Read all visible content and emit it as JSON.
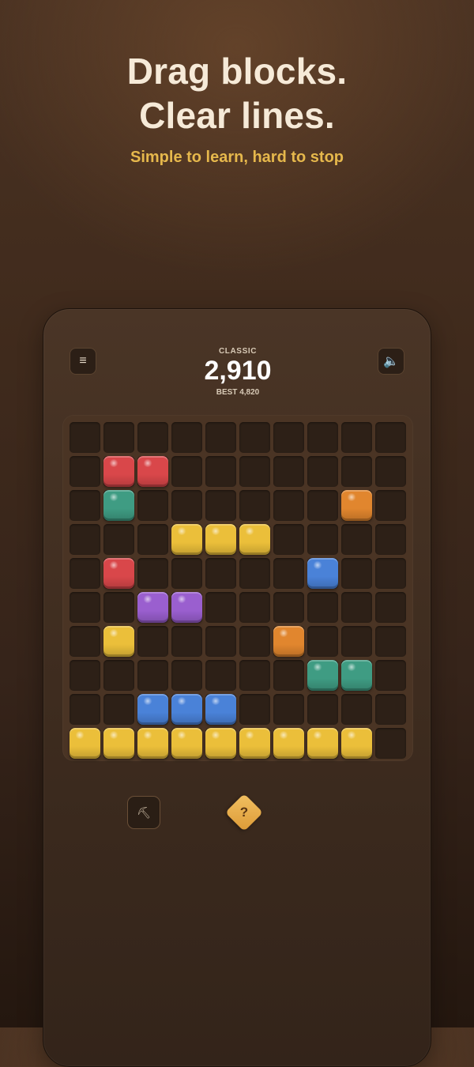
{
  "hero": {
    "headline_line1": "Drag blocks.",
    "headline_line2": "Clear lines.",
    "tagline": "Simple to learn, hard to stop"
  },
  "header": {
    "menu_icon": "menu-icon",
    "menu_glyph": "≡",
    "sound_icon": "speaker-icon",
    "sound_glyph": "🔈",
    "mode": "CLASSIC",
    "score": "2,910",
    "best": "BEST 4,820"
  },
  "board": {
    "rows": 10,
    "cols": 10,
    "colors": {
      "red": "#d9474a",
      "teal": "#3f9c83",
      "yellow": "#ebbf3a",
      "orange": "#e1862e",
      "blue": "#4a82d8",
      "purple": "#9a5fcf"
    },
    "blocks": [
      {
        "row": 1,
        "col": 1,
        "color": "red"
      },
      {
        "row": 1,
        "col": 2,
        "color": "red"
      },
      {
        "row": 2,
        "col": 1,
        "color": "teal"
      },
      {
        "row": 2,
        "col": 8,
        "color": "orange"
      },
      {
        "row": 3,
        "col": 3,
        "color": "yellow"
      },
      {
        "row": 3,
        "col": 4,
        "color": "yellow"
      },
      {
        "row": 3,
        "col": 5,
        "color": "yellow"
      },
      {
        "row": 4,
        "col": 1,
        "color": "red"
      },
      {
        "row": 4,
        "col": 7,
        "color": "blue"
      },
      {
        "row": 5,
        "col": 2,
        "color": "purple"
      },
      {
        "row": 5,
        "col": 3,
        "color": "purple"
      },
      {
        "row": 6,
        "col": 1,
        "color": "yellow"
      },
      {
        "row": 6,
        "col": 6,
        "color": "orange"
      },
      {
        "row": 7,
        "col": 7,
        "color": "teal"
      },
      {
        "row": 7,
        "col": 8,
        "color": "teal"
      },
      {
        "row": 8,
        "col": 2,
        "color": "blue"
      },
      {
        "row": 8,
        "col": 3,
        "color": "blue"
      },
      {
        "row": 8,
        "col": 4,
        "color": "blue"
      },
      {
        "row": 9,
        "col": 0,
        "color": "yellow"
      },
      {
        "row": 9,
        "col": 1,
        "color": "yellow"
      },
      {
        "row": 9,
        "col": 2,
        "color": "yellow"
      },
      {
        "row": 9,
        "col": 3,
        "color": "yellow"
      },
      {
        "row": 9,
        "col": 4,
        "color": "yellow"
      },
      {
        "row": 9,
        "col": 5,
        "color": "yellow"
      },
      {
        "row": 9,
        "col": 6,
        "color": "yellow"
      },
      {
        "row": 9,
        "col": 7,
        "color": "yellow"
      },
      {
        "row": 9,
        "col": 8,
        "color": "yellow"
      }
    ]
  },
  "tools": {
    "hammer_icon": "hammer-icon",
    "hammer_glyph": "⛏",
    "hint_icon": "hint-icon",
    "hint_label": "?"
  }
}
